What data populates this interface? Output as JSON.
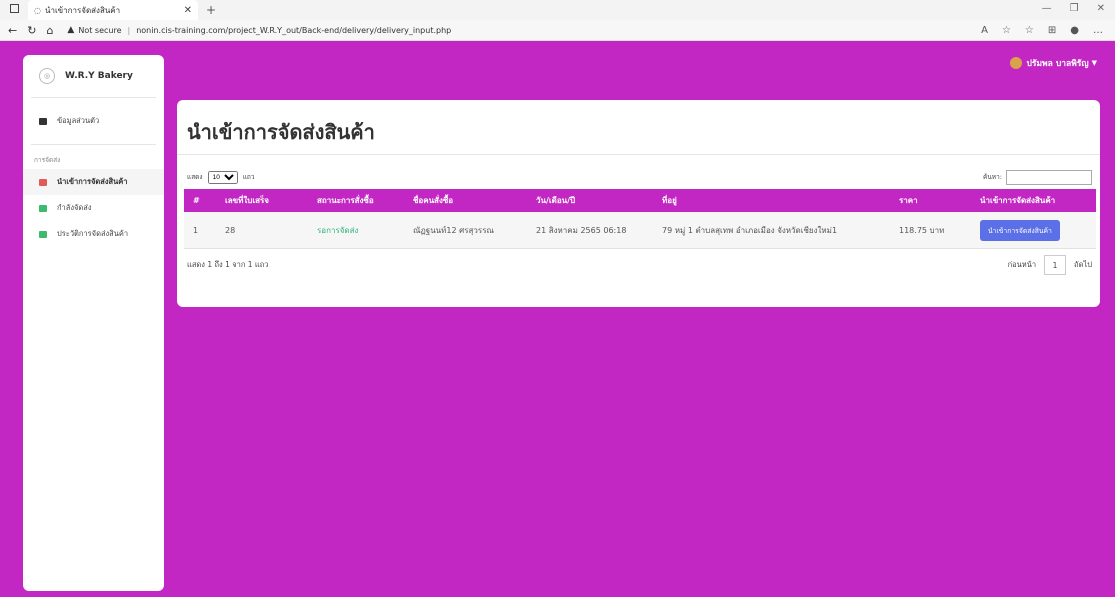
{
  "browser": {
    "tab_title": "นำเข้าการจัดส่งสินค้า",
    "url_warning": "Not secure",
    "url": "nonin.cis-training.com/project_W.R.Y_out/Back-end/delivery/delivery_input.php"
  },
  "sidebar": {
    "brand": "W.R.Y Bakery",
    "profile_label": "ข้อมูลส่วนตัว",
    "section_title": "การจัดส่ง",
    "items": [
      {
        "label": "นำเข้าการจัดส่งสินค้า",
        "color": "#e05a5a"
      },
      {
        "label": "กำลังจัดส่ง",
        "color": "#3cba6e"
      },
      {
        "label": "ประวัติการจัดส่งสินค้า",
        "color": "#3cba6e"
      }
    ]
  },
  "header": {
    "user_name": "ปรัมพล บาลพิรัญ"
  },
  "main": {
    "title": "นำเข้าการจัดส่งสินค้า",
    "show_prefix": "แสดง",
    "show_value": "10",
    "show_suffix": "แถว",
    "search_label": "ค้นหา:",
    "columns": [
      "#",
      "เลขที่ใบเสร็จ",
      "สถานะการสั่งซื้อ",
      "ชื่อคนสั่งซื้อ",
      "วัน/เดือน/ปี",
      "ที่อยู่",
      "ราคา",
      "นำเข้าการจัดส่งสินค้า"
    ],
    "rows": [
      {
        "index": "1",
        "receipt": "28",
        "status": "รอการจัดส่ง",
        "customer": "ณัฏฐนนท์12 ศรสุวรรณ",
        "date": "21 สิงหาคม 2565 06:18",
        "address": "79 หมู่ 1 ตำบลสุเทพ อำเภอเมือง จังหวัดเชียงใหม่1",
        "price": "118.75 บาท",
        "action": "นำเข้าการจัดส่งสินค้า"
      }
    ],
    "info": "แสดง 1 ถึง 1 จาก 1 แถว",
    "prev": "ก่อนหน้า",
    "page": "1",
    "next": "ถัดไป"
  },
  "colors": {
    "accent": "#c327c3",
    "button": "#5b6fe6",
    "status": "#2fb37c"
  }
}
